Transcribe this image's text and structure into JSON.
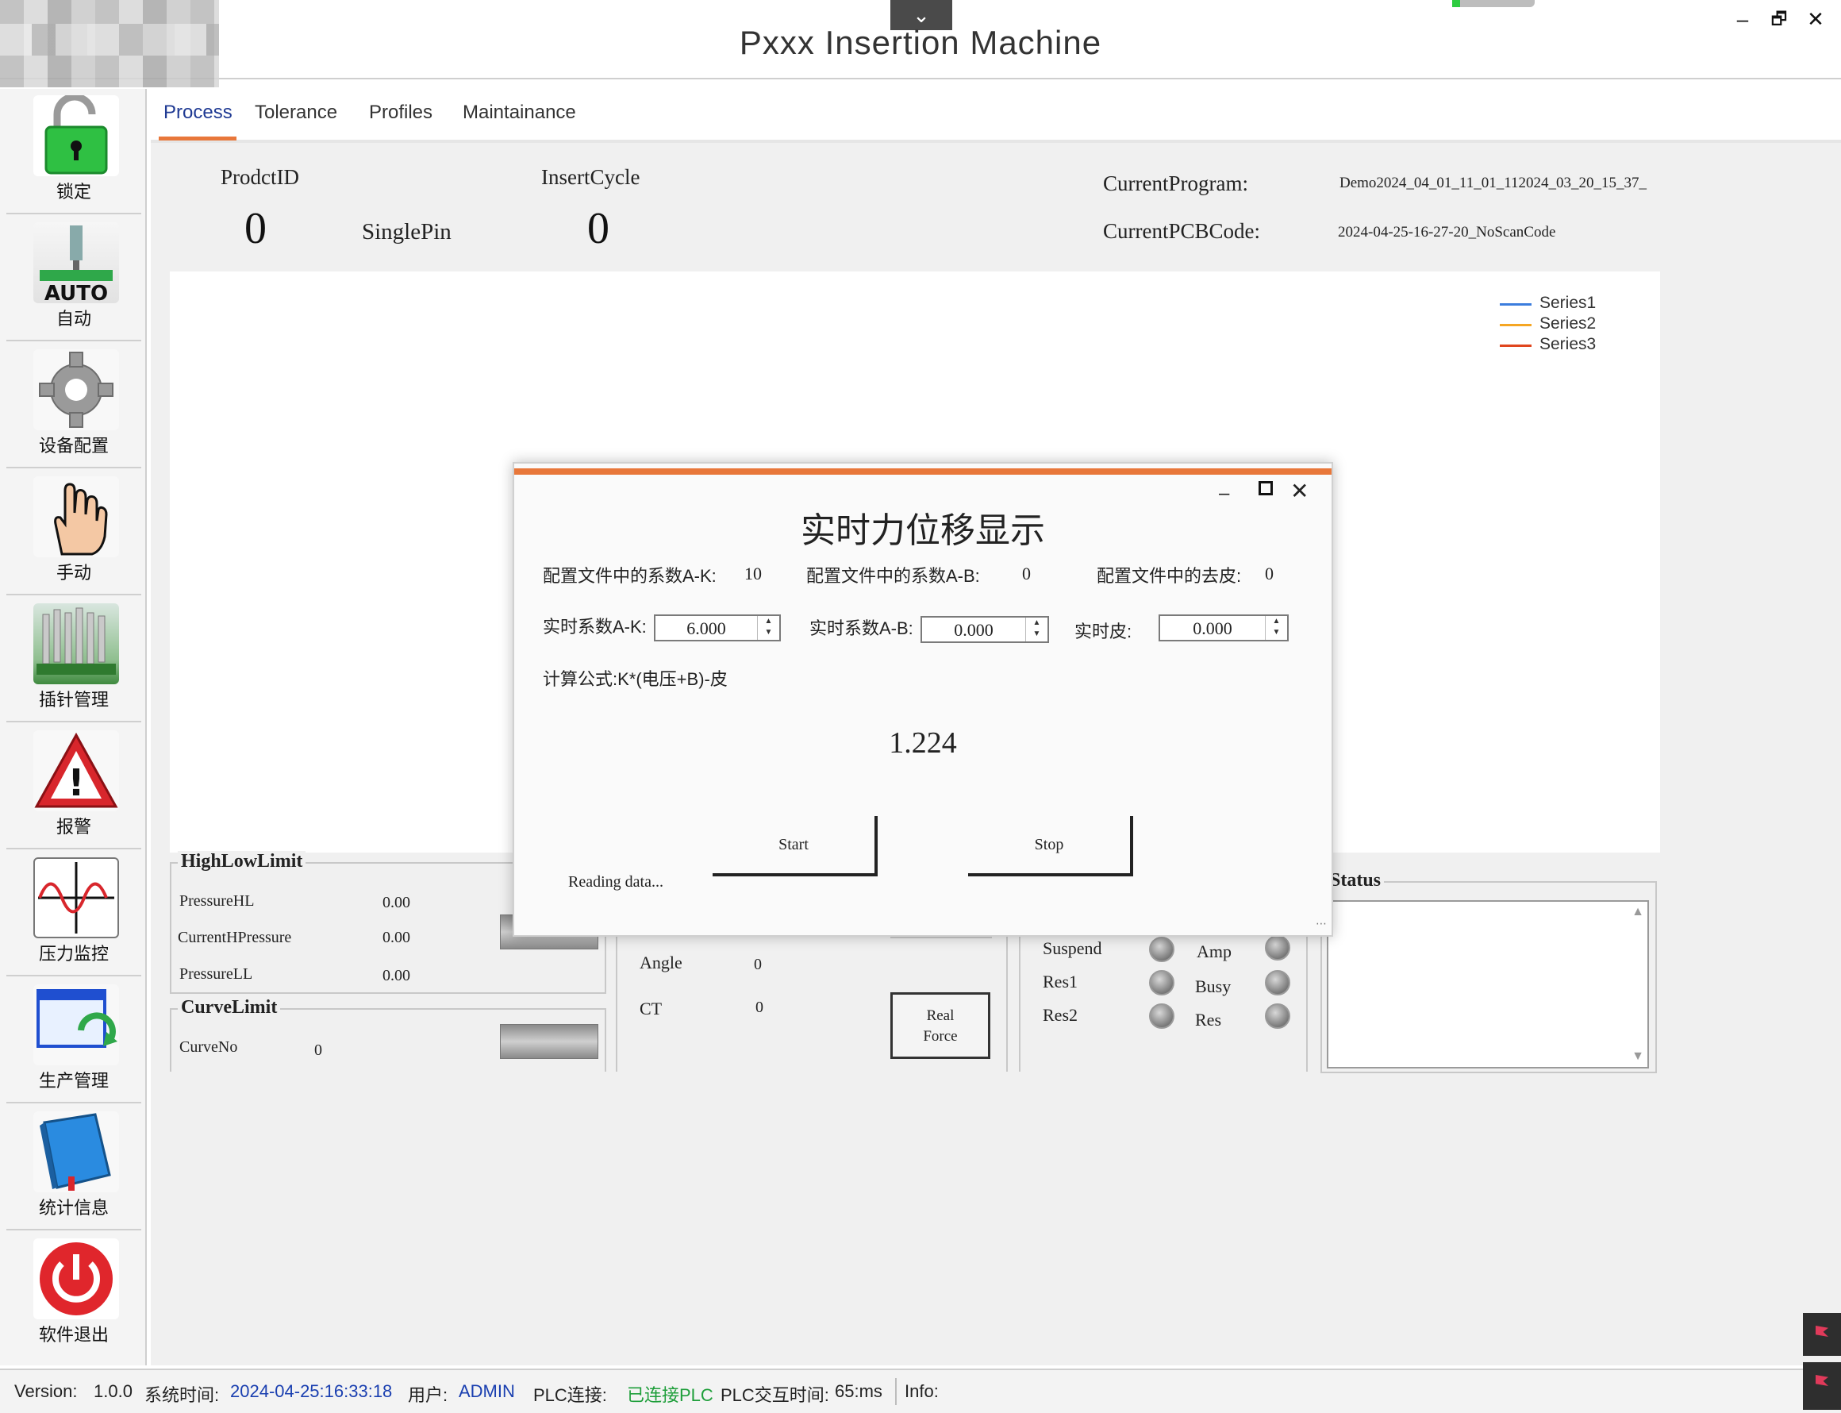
{
  "window": {
    "title": "Pxxx Insertion Machine",
    "collapse_glyph": "⌄",
    "minimize_glyph": "–",
    "restore_glyph": "🗗",
    "close_glyph": "✕"
  },
  "sidebar": {
    "items": [
      {
        "label": "锁定",
        "icon": "lock-icon"
      },
      {
        "label": "自动",
        "icon": "auto-icon",
        "badge": "AUTO"
      },
      {
        "label": "设备配置",
        "icon": "gear-icon"
      },
      {
        "label": "手动",
        "icon": "hand-icon"
      },
      {
        "label": "插针管理",
        "icon": "pins-icon"
      },
      {
        "label": "报警",
        "icon": "warning-icon",
        "badge": "!"
      },
      {
        "label": "压力监控",
        "icon": "pressure-chart-icon"
      },
      {
        "label": "生产管理",
        "icon": "refresh-window-icon"
      },
      {
        "label": "统计信息",
        "icon": "book-icon"
      },
      {
        "label": "软件退出",
        "icon": "power-icon"
      }
    ]
  },
  "tabs": [
    "Process",
    "Tolerance",
    "Profiles",
    "Maintainance"
  ],
  "process": {
    "product_id_label": "ProdctID",
    "product_id_value": "0",
    "mode_label": "SinglePin",
    "insert_cycle_label": "InsertCycle",
    "insert_cycle_value": "0",
    "current_program_label": "CurrentProgram:",
    "current_program_value": "Demo2024_04_01_11_01_112024_03_20_15_37_",
    "current_pcb_label": "CurrentPCBCode:",
    "current_pcb_value": "2024-04-25-16-27-20_NoScanCode"
  },
  "chart": {
    "legend": [
      {
        "name": "Series1",
        "color": "#3b7ddd"
      },
      {
        "name": "Series2",
        "color": "#f5a623"
      },
      {
        "name": "Series3",
        "color": "#e0461e"
      }
    ]
  },
  "high_low_limit": {
    "title": "HighLowLimit",
    "rows": [
      {
        "label": "PressureHL",
        "value": "0.00"
      },
      {
        "label": "CurrentHPressure",
        "value": "0.00"
      },
      {
        "label": "PressureLL",
        "value": "0.00"
      }
    ]
  },
  "curve_limit": {
    "title": "CurveLimit",
    "label": "CurveNo",
    "value": "0"
  },
  "motion": {
    "angle_label": "Angle",
    "angle_value": "0",
    "ct_label": "CT",
    "ct_value": "0",
    "real_force_line1": "Real",
    "real_force_line2": "Force"
  },
  "signals": {
    "left": [
      "Suspend",
      "Res1",
      "Res2"
    ],
    "right": [
      "Amp",
      "Busy",
      "Res"
    ]
  },
  "status": {
    "title": "Status"
  },
  "statusbar": {
    "version_label": "Version:",
    "version_value": "1.0.0",
    "time_label": "系统时间:",
    "time_value": "2024-04-25:16:33:18",
    "user_label": "用户:",
    "user_value": "ADMIN",
    "plc_label": "PLC连接:",
    "plc_value": "已连接PLC",
    "plc_time_label": "PLC交互时间:",
    "plc_time_value": "65:ms",
    "info_label": "Info:",
    "colors": {
      "link": "#1a3fb0",
      "ok": "#1e9e3a"
    }
  },
  "dialog": {
    "title": "实时力位移显示",
    "cfg_ak_label": "配置文件中的系数A-K:",
    "cfg_ak_value": "10",
    "cfg_ab_label": "配置文件中的系数A-B:",
    "cfg_ab_value": "0",
    "cfg_tare_label": "配置文件中的去皮:",
    "cfg_tare_value": "0",
    "rt_ak_label": "实时系数A-K:",
    "rt_ak_value": "6.000",
    "rt_ab_label": "实时系数A-B:",
    "rt_ab_value": "0.000",
    "rt_tare_label": "实时皮:",
    "rt_tare_value": "0.000",
    "formula": "计算公式:K*(电压+B)-皮",
    "result": "1.224",
    "start_label": "Start",
    "stop_label": "Stop",
    "reading_text": "Reading data..."
  }
}
